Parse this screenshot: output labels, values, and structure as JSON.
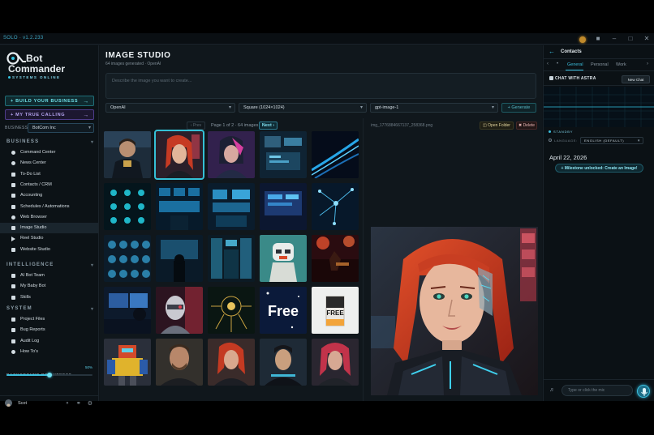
{
  "window": {
    "version": "SOLO · v1.2.233"
  },
  "brand": {
    "line1": "Bot",
    "line2": "Commander",
    "subtitle": "SYSTEMS ONLINE"
  },
  "sidebar": {
    "cta_build": "BUILD YOUR BUSINESS",
    "cta_calling": "MY TRUE CALLING",
    "business_label": "BUSINESS:",
    "business_value": "BotCom Inc",
    "sections": [
      {
        "title": "BUSINESS",
        "items": [
          {
            "label": "Command Center",
            "icon": "dot-icon"
          },
          {
            "label": "News Center",
            "icon": "dot-icon"
          },
          {
            "label": "To-Do List",
            "icon": "checkbox-icon"
          },
          {
            "label": "Contacts / CRM",
            "icon": "contacts-icon"
          },
          {
            "label": "Accounting",
            "icon": "dollar-icon"
          },
          {
            "label": "Schedules / Automations",
            "icon": "calendar-icon"
          },
          {
            "label": "Web Browser",
            "icon": "globe-icon"
          },
          {
            "label": "Image Studio",
            "icon": "image-icon"
          },
          {
            "label": "Reel Studio",
            "icon": "play-icon"
          },
          {
            "label": "Website Studio",
            "icon": "website-icon"
          }
        ]
      },
      {
        "title": "INTELLIGENCE",
        "items": [
          {
            "label": "AI Bot Team",
            "icon": "bot-icon"
          },
          {
            "label": "My Baby Bot",
            "icon": "baby-bot-icon"
          },
          {
            "label": "Skills",
            "icon": "skills-icon"
          }
        ]
      },
      {
        "title": "SYSTEM",
        "items": [
          {
            "label": "Project Files",
            "icon": "folder-icon"
          },
          {
            "label": "Bug Reports",
            "icon": "bug-icon"
          },
          {
            "label": "Audit Log",
            "icon": "log-icon"
          },
          {
            "label": "How To's",
            "icon": "help-icon"
          }
        ]
      }
    ],
    "brightness_label": "BACKGROUND BRIGHTNESS",
    "brightness_value": "50%",
    "brightness_level": 0.5,
    "user_name": "Scot"
  },
  "studio": {
    "title": "IMAGE STUDIO",
    "subtitle": "64 images generated · OpenAI",
    "prompt_placeholder": "Describe the image you want to create...",
    "provider": "OpenAI",
    "size": "Square (1024×1024)",
    "model": "gpt-image-1",
    "generate_label": "+ Generate",
    "pager_prev": "‹ Prev",
    "pager_text": "Page 1 of 2 · 64 images",
    "pager_next": "Next ›",
    "selected_file": "img_1776884667137_258368.png",
    "open_folder": "Open Folder",
    "delete": "Delete",
    "thumb_text_free1": "Free",
    "thumb_text_free2": "FREE"
  },
  "contacts_panel": {
    "title": "Contacts",
    "tabs": [
      "General",
      "Personal",
      "Work"
    ],
    "chat_title": "CHAT WITH ASTRA",
    "new_chat": "New Chat",
    "status": "STANDBY",
    "language_label": "LANGUAGE:",
    "language_value": "ENGLISH (DEFAULT)",
    "date": "April 22, 2026",
    "milestone": "Milestone unlocked: Create an Image!",
    "input_placeholder": "Type or click the mic"
  },
  "colors": {
    "accent": "#3bbedc",
    "background": "#0e1419"
  }
}
